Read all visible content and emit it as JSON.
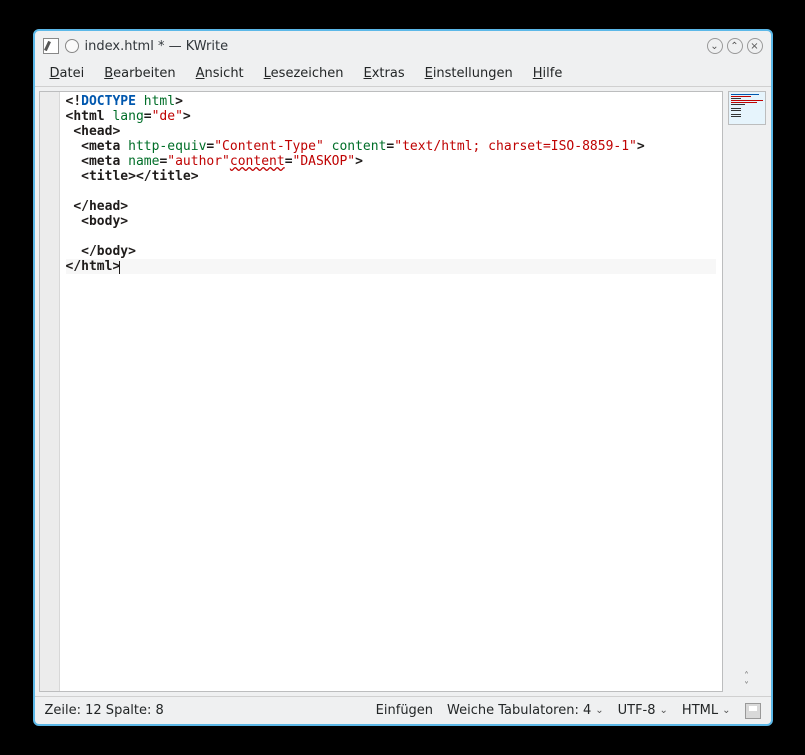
{
  "window": {
    "title": "index.html * — KWrite"
  },
  "menubar": {
    "items": [
      {
        "label": "Datei",
        "mnemonic": "D"
      },
      {
        "label": "Bearbeiten",
        "mnemonic": "B"
      },
      {
        "label": "Ansicht",
        "mnemonic": "A"
      },
      {
        "label": "Lesezeichen",
        "mnemonic": "L"
      },
      {
        "label": "Extras",
        "mnemonic": "E"
      },
      {
        "label": "Einstellungen",
        "mnemonic": "E"
      },
      {
        "label": "Hilfe",
        "mnemonic": "H"
      }
    ]
  },
  "code": {
    "lines": [
      {
        "indent": 0,
        "tokens": [
          {
            "t": "<!",
            "c": "tag"
          },
          {
            "t": "DOCTYPE",
            "c": "doctype-kw"
          },
          {
            "t": " html",
            "c": "attr"
          },
          {
            "t": ">",
            "c": "tag"
          }
        ]
      },
      {
        "indent": 0,
        "tokens": [
          {
            "t": "<html",
            "c": "tag"
          },
          {
            "t": " lang",
            "c": "attr"
          },
          {
            "t": "=",
            "c": "tag"
          },
          {
            "t": "\"de\"",
            "c": "val"
          },
          {
            "t": ">",
            "c": "tag"
          }
        ]
      },
      {
        "indent": 1,
        "tokens": [
          {
            "t": "<head>",
            "c": "tag"
          }
        ]
      },
      {
        "indent": 2,
        "tokens": [
          {
            "t": "<meta",
            "c": "tag"
          },
          {
            "t": " http-equiv",
            "c": "attr"
          },
          {
            "t": "=",
            "c": "tag"
          },
          {
            "t": "\"Content-Type\"",
            "c": "val"
          },
          {
            "t": " content",
            "c": "attr"
          },
          {
            "t": "=",
            "c": "tag"
          },
          {
            "t": "\"text/html; charset=ISO-8859-1\"",
            "c": "val"
          },
          {
            "t": ">",
            "c": "tag"
          }
        ]
      },
      {
        "indent": 2,
        "tokens": [
          {
            "t": "<meta",
            "c": "tag"
          },
          {
            "t": " name",
            "c": "attr"
          },
          {
            "t": "=",
            "c": "tag"
          },
          {
            "t": "\"author\"",
            "c": "val"
          },
          {
            "t": "content",
            "c": "err"
          },
          {
            "t": "=",
            "c": "tag"
          },
          {
            "t": "\"DASKOP\"",
            "c": "val"
          },
          {
            "t": ">",
            "c": "tag"
          }
        ]
      },
      {
        "indent": 2,
        "tokens": [
          {
            "t": "<title></title>",
            "c": "tag"
          }
        ]
      },
      {
        "indent": 0,
        "tokens": []
      },
      {
        "indent": 1,
        "tokens": [
          {
            "t": "</head>",
            "c": "tag"
          }
        ]
      },
      {
        "indent": 2,
        "tokens": [
          {
            "t": "<body>",
            "c": "tag"
          }
        ]
      },
      {
        "indent": 0,
        "tokens": []
      },
      {
        "indent": 2,
        "tokens": [
          {
            "t": "</body>",
            "c": "tag"
          }
        ]
      },
      {
        "indent": 0,
        "cursor": true,
        "highlight": true,
        "tokens": [
          {
            "t": "</html>",
            "c": "tag"
          }
        ]
      }
    ]
  },
  "statusbar": {
    "position": "Zeile: 12 Spalte: 8",
    "insert_mode": "Einfügen",
    "tabs_label": "Weiche Tabulatoren: 4",
    "encoding": "UTF-8",
    "syntax": "HTML"
  }
}
